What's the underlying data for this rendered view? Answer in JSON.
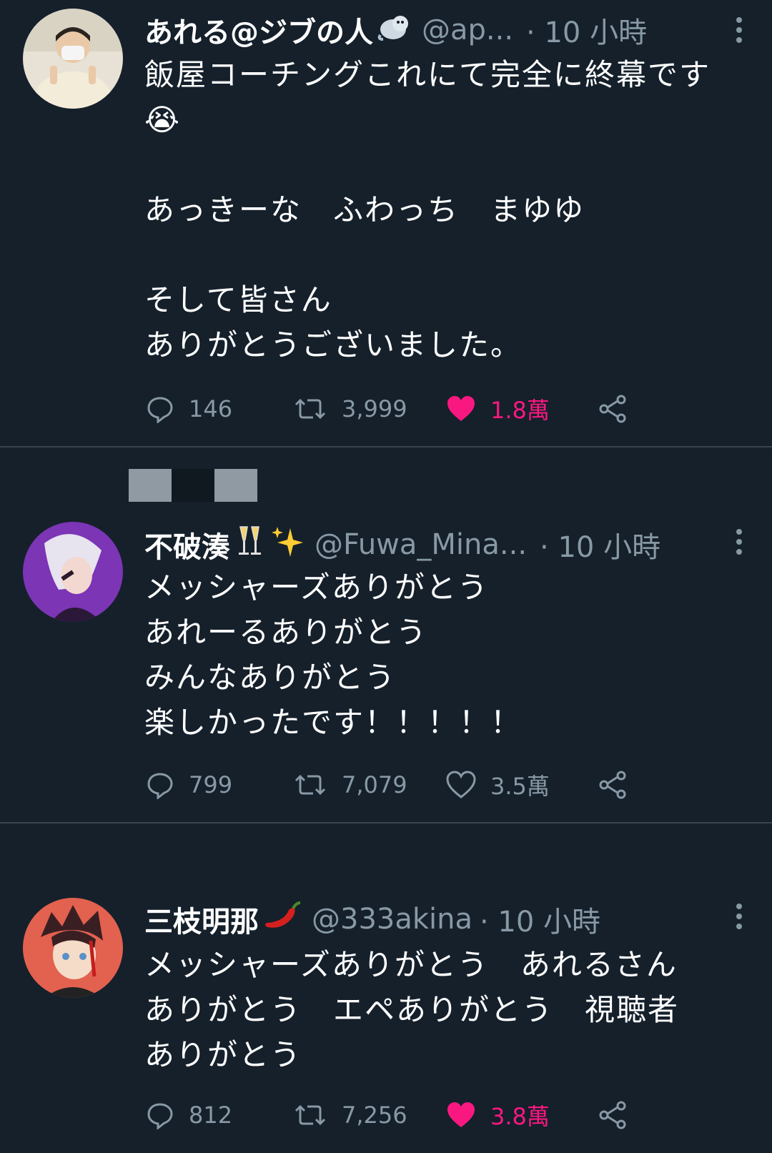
{
  "tweets": [
    {
      "name": "あれる@ジブの人",
      "name_emoji": "seal-emoji",
      "handle": "@ap...",
      "time": "· 10 小時",
      "text": "飯屋コーチングこれにて完全に終幕です😭\n\nあっきーな　ふわっち　まゆゆ\n\nそして皆さん\nありがとうございました。",
      "replies": "146",
      "retweets": "3,999",
      "likes": "1.8萬",
      "liked": true
    },
    {
      "name": "不破湊",
      "name_emoji": "champagne-sparkles-emoji",
      "handle": "@Fuwa_Mina...",
      "time": "· 10 小時",
      "text": "メッシャーズありがとう\nあれーるありがとう\nみんなありがとう\n楽しかったです！！！！！",
      "replies": "799",
      "retweets": "7,079",
      "likes": "3.5萬",
      "liked": false
    },
    {
      "name": "三枝明那",
      "name_emoji": "chili-pepper-emoji",
      "handle": "@333akina",
      "time": "· 10 小時",
      "text": "メッシャーズありがとう　あれるさん\nありがとう　エペありがとう　視聴者\nありがとう",
      "replies": "812",
      "retweets": "7,256",
      "likes": "3.8萬",
      "liked": true
    }
  ],
  "colors": {
    "background": "#15202b",
    "divider": "#38444d",
    "secondary_text": "#8899a6",
    "like_active": "#f91880"
  },
  "icons": [
    "reply-icon",
    "retweet-icon",
    "like-icon",
    "share-icon",
    "more-options-icon"
  ]
}
